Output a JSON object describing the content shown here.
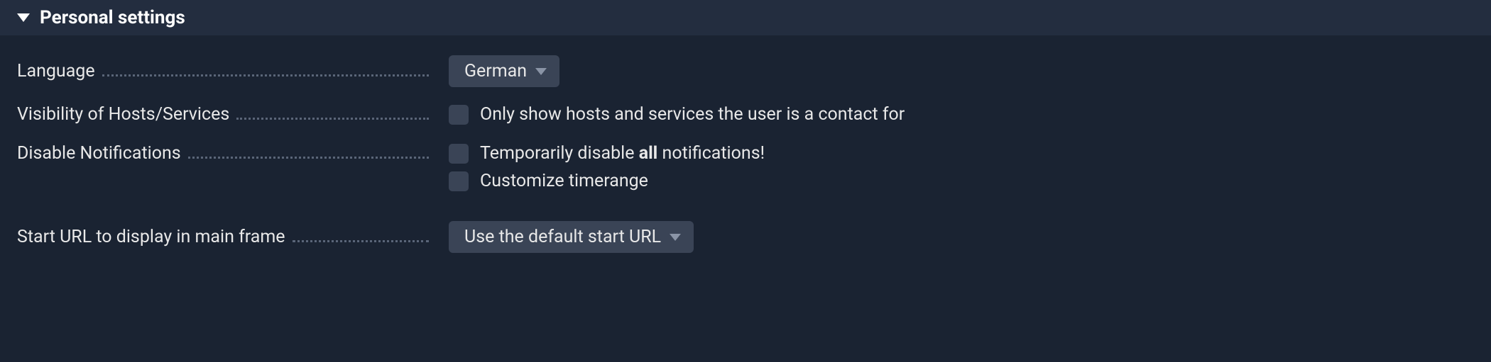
{
  "section": {
    "title": "Personal settings"
  },
  "settings": {
    "language": {
      "label": "Language",
      "value": "German"
    },
    "visibility": {
      "label": "Visibility of Hosts/Services",
      "checkbox_label": "Only show hosts and services the user is a contact for"
    },
    "disable_notifications": {
      "label": "Disable Notifications",
      "checkbox1_prefix": "Temporarily disable ",
      "checkbox1_bold": "all",
      "checkbox1_suffix": " notifications!",
      "checkbox2_label": "Customize timerange"
    },
    "start_url": {
      "label": "Start URL to display in main frame",
      "value": "Use the default start URL"
    }
  }
}
